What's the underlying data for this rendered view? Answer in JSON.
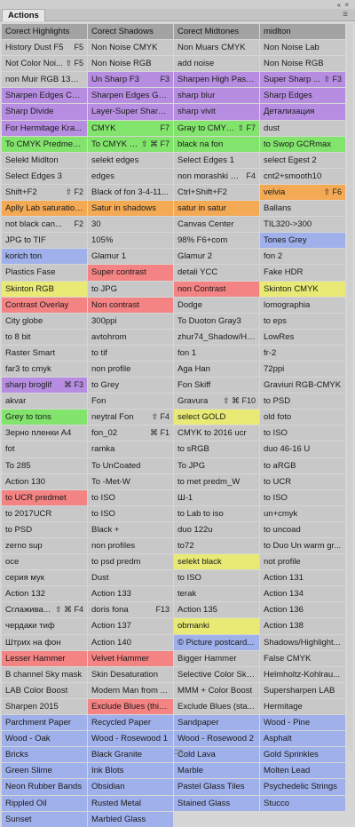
{
  "window": {
    "controls": "«  ×",
    "tab": "Actions",
    "menu_icon": "≡"
  },
  "rows": [
    [
      {
        "t": "Corect Highlights",
        "c": "hdr"
      },
      {
        "t": "Corect Shadows",
        "c": "hdr"
      },
      {
        "t": "Corect Midtones",
        "c": "hdr"
      },
      {
        "t": "midlton",
        "c": "hdr"
      }
    ],
    [
      {
        "t": "History Dust F5",
        "s": "F5"
      },
      {
        "t": "Non Noise CMYK"
      },
      {
        "t": "Non Muars CMYK"
      },
      {
        "t": "Non Noise Lab"
      }
    ],
    [
      {
        "t": "Not Color Noi...",
        "s": "⇧ F5"
      },
      {
        "t": "Non Noise RGB"
      },
      {
        "t": "add noise"
      },
      {
        "t": "Non Noise RGB"
      }
    ],
    [
      {
        "t": "non Muir RGB 133LPI"
      },
      {
        "t": "Un Sharp F3",
        "s": "F3",
        "c": "c-purple"
      },
      {
        "t": "Sharpen High Pass...",
        "c": "c-purple"
      },
      {
        "t": "Super Sharp ...",
        "s": "⇧ F3",
        "c": "c-purple"
      }
    ],
    [
      {
        "t": "Sharpen Edges CM...",
        "c": "c-purple"
      },
      {
        "t": "Sharpen Edges Gra...",
        "c": "c-purple"
      },
      {
        "t": "sharp blur",
        "c": "c-purple"
      },
      {
        "t": "Sharp Edges",
        "c": "c-purple"
      }
    ],
    [
      {
        "t": "Sharp Divide",
        "c": "c-purple"
      },
      {
        "t": "Layer-Super Sharp ...",
        "c": "c-purple"
      },
      {
        "t": "sharp vivit",
        "c": "c-purple"
      },
      {
        "t": "Детализация",
        "c": "c-purple"
      }
    ],
    [
      {
        "t": "For Hermitage Kra...",
        "c": "c-purple"
      },
      {
        "t": "CMYK",
        "s": "F7",
        "c": "c-green"
      },
      {
        "t": "Gray to CMYK...",
        "s": "⇧ F7",
        "c": "c-green"
      },
      {
        "t": "dust"
      }
    ],
    [
      {
        "t": "To CMYK Predmet ...",
        "c": "c-green"
      },
      {
        "t": "To CMYK P...",
        "s": "⇧ ⌘ F7",
        "c": "c-green"
      },
      {
        "t": "black na fon",
        "c": "c-green"
      },
      {
        "t": "to Swop GCRmax",
        "c": "c-green"
      }
    ],
    [
      {
        "t": "Selekt Midlton"
      },
      {
        "t": "selekt edges"
      },
      {
        "t": "Select Edges 1"
      },
      {
        "t": "select Egest 2"
      }
    ],
    [
      {
        "t": "Select Edges 3"
      },
      {
        "t": "edges"
      },
      {
        "t": "non morashki W...",
        "s": "F4"
      },
      {
        "t": "cnt2+smooth10"
      }
    ],
    [
      {
        "t": "Shift+F2",
        "s": "⇧ F2"
      },
      {
        "t": "Black of fon 3-4-11..."
      },
      {
        "t": "Ctrl+Shift+F2"
      },
      {
        "t": "velvia",
        "s": "⇧ F6",
        "c": "c-orange"
      }
    ],
    [
      {
        "t": "Aplly Lab saturations",
        "c": "c-orange"
      },
      {
        "t": "Satur in shadows",
        "c": "c-orange"
      },
      {
        "t": "satur in satur",
        "c": "c-orange"
      },
      {
        "t": "Ballans"
      }
    ],
    [
      {
        "t": "not black can...",
        "s": "F2"
      },
      {
        "t": "30"
      },
      {
        "t": "Canvas Center"
      },
      {
        "t": "TIL320->300"
      }
    ],
    [
      {
        "t": "JPG to TIF"
      },
      {
        "t": "105%"
      },
      {
        "t": "98%  F6+com"
      },
      {
        "t": "Tones Grey",
        "c": "c-blue"
      }
    ],
    [
      {
        "t": "korich ton",
        "c": "c-blue"
      },
      {
        "t": "Glamur 1"
      },
      {
        "t": "Glamur 2"
      },
      {
        "t": "fon 2"
      }
    ],
    [
      {
        "t": "Plastics  Fase"
      },
      {
        "t": "Super contrast",
        "c": "c-red"
      },
      {
        "t": "detali YCC"
      },
      {
        "t": "Fake HDR"
      }
    ],
    [
      {
        "t": "Skinton RGB",
        "c": "c-yellow"
      },
      {
        "t": "to JPG"
      },
      {
        "t": "non Contrast",
        "c": "c-red"
      },
      {
        "t": "Skinton CMYK",
        "c": "c-yellow"
      }
    ],
    [
      {
        "t": "Contrast Overlay",
        "c": "c-red"
      },
      {
        "t": "Non contrast",
        "c": "c-red"
      },
      {
        "t": "Dodge"
      },
      {
        "t": "lomographia"
      }
    ],
    [
      {
        "t": "City globe"
      },
      {
        "t": "300ppi"
      },
      {
        "t": "To Duoton Gray3"
      },
      {
        "t": "to eps"
      }
    ],
    [
      {
        "t": "to 8 bit"
      },
      {
        "t": "avtohrom"
      },
      {
        "t": "zhur74_Shadow/Hi..."
      },
      {
        "t": "LowRes"
      }
    ],
    [
      {
        "t": "Raster Smart"
      },
      {
        "t": "to tif"
      },
      {
        "t": "fon 1"
      },
      {
        "t": "fr-2"
      }
    ],
    [
      {
        "t": "far3 to cmyk"
      },
      {
        "t": "non profile"
      },
      {
        "t": "Aga Han"
      },
      {
        "t": "72ppi"
      }
    ],
    [
      {
        "t": "sharp broglif",
        "s": "⌘ F3",
        "c": "c-purple"
      },
      {
        "t": "to Grey"
      },
      {
        "t": "Fon Skiff"
      },
      {
        "t": "Graviuri RGB-CMYK"
      }
    ],
    [
      {
        "t": "akvar"
      },
      {
        "t": "Fon"
      },
      {
        "t": "Gravura",
        "s": "⇧ ⌘ F10"
      },
      {
        "t": "to PSD"
      }
    ],
    [
      {
        "t": "Grey to tons",
        "c": "c-green"
      },
      {
        "t": "neytral Fon",
        "s": "⇧ F4"
      },
      {
        "t": "select GOLD",
        "c": "c-yellow"
      },
      {
        "t": "old foto"
      }
    ],
    [
      {
        "t": "Зерно пленки A4",
        "c": "c-gray"
      },
      {
        "t": "fon_02",
        "s": "⌘ F1"
      },
      {
        "t": "CMYK to 2016 ucr"
      },
      {
        "t": "to ISO"
      }
    ],
    [
      {
        "t": "fot"
      },
      {
        "t": "ramka"
      },
      {
        "t": "to sRGB"
      },
      {
        "t": "duo 46-16 U"
      }
    ],
    [
      {
        "t": "To 285"
      },
      {
        "t": "To UnCoated"
      },
      {
        "t": "To JPG"
      },
      {
        "t": "to aRGB"
      }
    ],
    [
      {
        "t": "Action 130"
      },
      {
        "t": "To -Met-W"
      },
      {
        "t": "to met predm_W"
      },
      {
        "t": "to UCR"
      }
    ],
    [
      {
        "t": "to UCR predmet",
        "c": "c-red"
      },
      {
        "t": "to ISO"
      },
      {
        "t": "Ш-1"
      },
      {
        "t": "to ISO"
      }
    ],
    [
      {
        "t": "to 2017UCR"
      },
      {
        "t": "to ISO"
      },
      {
        "t": "to Lab to iso"
      },
      {
        "t": "un+cmyk"
      }
    ],
    [
      {
        "t": "to PSD"
      },
      {
        "t": "Black +"
      },
      {
        "t": "duo 122u"
      },
      {
        "t": "to uncoad"
      }
    ],
    [
      {
        "t": "zerno sup"
      },
      {
        "t": "non profiles"
      },
      {
        "t": "to72"
      },
      {
        "t": "to Duo Un warm gr..."
      }
    ],
    [
      {
        "t": "oce"
      },
      {
        "t": "to psd predm"
      },
      {
        "t": "selekt black",
        "c": "c-yellow"
      },
      {
        "t": "not profile"
      }
    ],
    [
      {
        "t": "серия мук"
      },
      {
        "t": "Dust"
      },
      {
        "t": "to ISO"
      },
      {
        "t": "Action 131"
      }
    ],
    [
      {
        "t": "Action 132"
      },
      {
        "t": "Action 133"
      },
      {
        "t": "terak"
      },
      {
        "t": "Action 134"
      }
    ],
    [
      {
        "t": "Сглажива...",
        "s": "⇧ ⌘ F4"
      },
      {
        "t": "doris fona",
        "s": "F13"
      },
      {
        "t": "Action 135"
      },
      {
        "t": "Action 136"
      }
    ],
    [
      {
        "t": "чердаки тиф"
      },
      {
        "t": "Action 137"
      },
      {
        "t": "obmanki",
        "c": "c-yellow"
      },
      {
        "t": "Action 138"
      }
    ],
    [
      {
        "t": "Штрих на фон"
      },
      {
        "t": "Action 140"
      },
      {
        "t": "© Picture postcard...",
        "c": "c-blue"
      },
      {
        "t": "Shadows/Highlight..."
      }
    ],
    [
      {
        "t": "Lesser Hammer",
        "c": "c-red"
      },
      {
        "t": "Velvet Hammer",
        "c": "c-red"
      },
      {
        "t": "Bigger Hammer"
      },
      {
        "t": "False CMYK"
      }
    ],
    [
      {
        "t": "B channel Sky mask"
      },
      {
        "t": "Skin Desaturation"
      },
      {
        "t": "Selective Color Sky..."
      },
      {
        "t": "Helmholtz-Kohlrau..."
      }
    ],
    [
      {
        "t": "LAB Color Boost"
      },
      {
        "t": "Modern Man from ..."
      },
      {
        "t": "MMM + Color Boost"
      },
      {
        "t": "Supersharpen LAB"
      }
    ],
    [
      {
        "t": "Sharpen 2015"
      },
      {
        "t": "Exclude Blues (this...",
        "c": "c-red"
      },
      {
        "t": "Exclude Blues (sta..."
      },
      {
        "t": "Hermitage"
      }
    ],
    [
      {
        "t": "Parchment Paper",
        "c": "c-blue"
      },
      {
        "t": "Recycled Paper",
        "c": "c-blue"
      },
      {
        "t": "Sandpaper",
        "c": "c-blue"
      },
      {
        "t": "Wood - Pine",
        "c": "c-blue"
      }
    ],
    [
      {
        "t": "Wood - Oak",
        "c": "c-blue"
      },
      {
        "t": "Wood - Rosewood 1",
        "c": "c-blue"
      },
      {
        "t": "Wood - Rosewood 2",
        "c": "c-blue"
      },
      {
        "t": "Asphalt",
        "c": "c-blue"
      }
    ],
    [
      {
        "t": "Bricks",
        "c": "c-blue"
      },
      {
        "t": "Black Granite",
        "c": "c-blue"
      },
      {
        "t": "Cold Lava",
        "c": "c-blue"
      },
      {
        "t": "Gold Sprinkles",
        "c": "c-blue"
      }
    ],
    [
      {
        "t": "Green Slime",
        "c": "c-blue"
      },
      {
        "t": "Ink Blots",
        "c": "c-blue"
      },
      {
        "t": "Marble",
        "c": "c-blue"
      },
      {
        "t": "Molten Lead",
        "c": "c-blue"
      }
    ],
    [
      {
        "t": "Neon Rubber Bands",
        "c": "c-blue"
      },
      {
        "t": "Obsidian",
        "c": "c-blue"
      },
      {
        "t": "Pastel Glass Tiles",
        "c": "c-blue"
      },
      {
        "t": "Psychedelic Strings",
        "c": "c-blue"
      }
    ],
    [
      {
        "t": "Rippled Oil",
        "c": "c-blue"
      },
      {
        "t": "Rusted Metal",
        "c": "c-blue"
      },
      {
        "t": "Stained Glass",
        "c": "c-blue"
      },
      {
        "t": "Stucco",
        "c": "c-blue"
      }
    ],
    [
      {
        "t": "Sunset",
        "c": "c-blue"
      },
      {
        "t": "Marbled Glass",
        "c": "c-blue"
      },
      null,
      null
    ]
  ]
}
